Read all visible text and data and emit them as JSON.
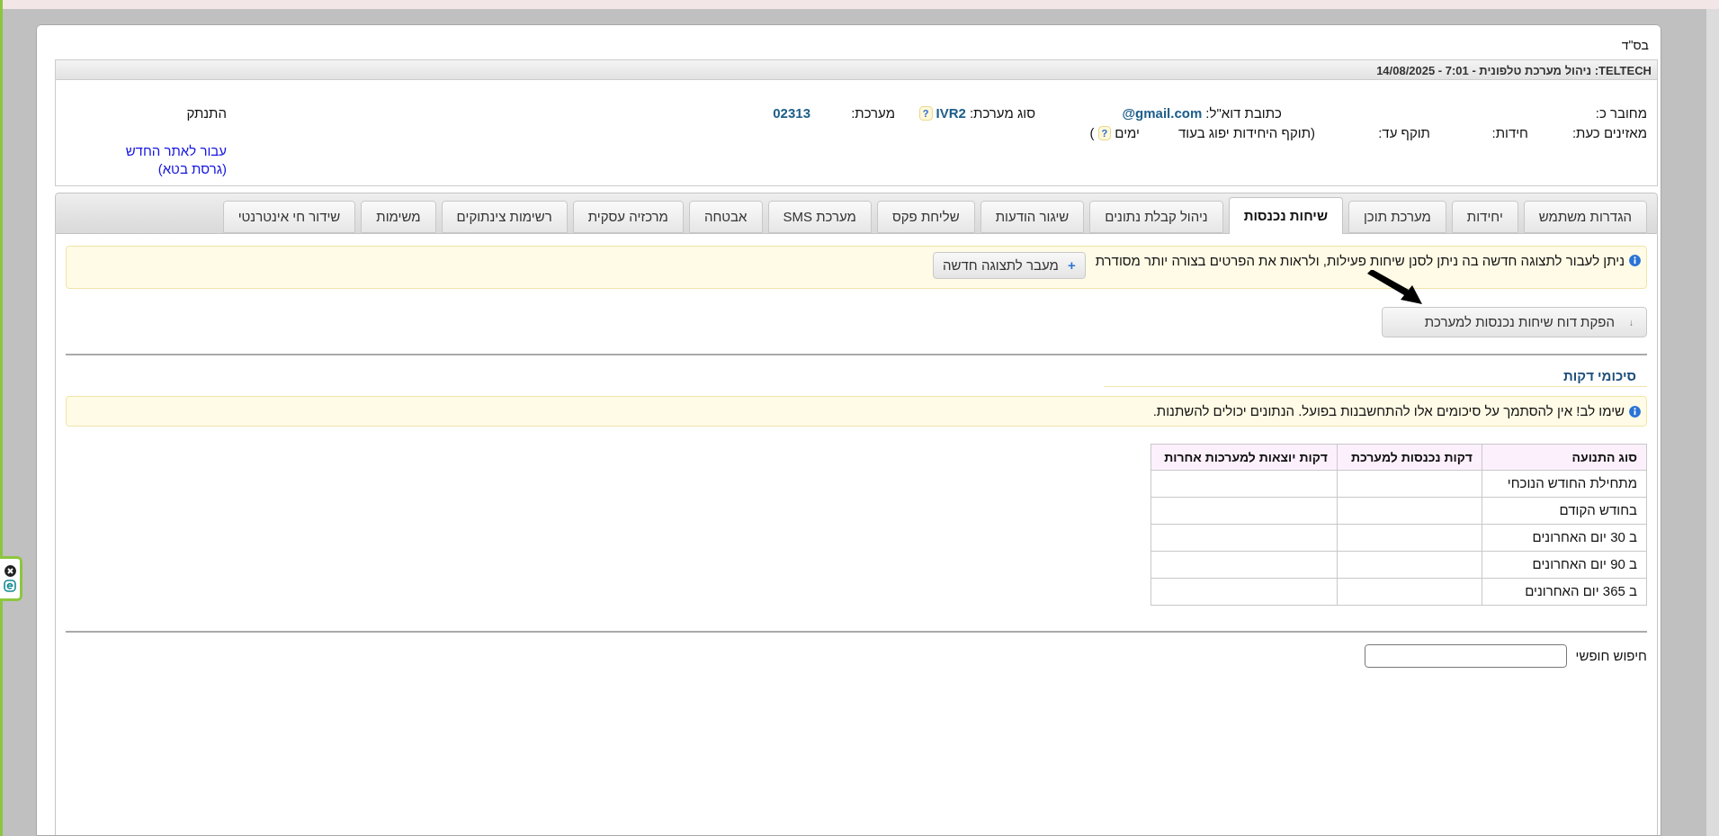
{
  "blessing": "בס\"ד",
  "title_bar": "TELTECH: ניהול מערכת טלפונית - 7:01 - 14/08/2025",
  "account": {
    "connected_as": "מחובר כ:",
    "email_label": "כתובת דוא\"ל:",
    "email": "@gmail.com",
    "system_type_label": "סוג מערכת:",
    "system_type": "IVR2",
    "system_type_help": "?",
    "system_label": "מערכת:",
    "system_number": "02313",
    "logout": "התנתק",
    "listeners_label": "מאזינים כעת:",
    "units_label": "חידות:",
    "valid_until_label": "תוקף עד:",
    "expiry_note": "(תוקף היחידות יפוג בעוד",
    "days": "ימים",
    "days_help": "?",
    "close_paren": ")",
    "new_site_link": "עבור לאתר החדש",
    "beta_link": "(גרסת בטא)"
  },
  "tabs": [
    {
      "label": "הגדרות משתמש",
      "selected": false
    },
    {
      "label": "יחידות",
      "selected": false
    },
    {
      "label": "מערכת תוכן",
      "selected": false
    },
    {
      "label": "שיחות נכנסות",
      "selected": true
    },
    {
      "label": "ניהול קבלת נתונים",
      "selected": false
    },
    {
      "label": "שיגור הודעות",
      "selected": false
    },
    {
      "label": "שליחת פקס",
      "selected": false
    },
    {
      "label": "מערכת SMS",
      "selected": false
    },
    {
      "label": "אבטחה",
      "selected": false
    },
    {
      "label": "מרכזיה עסקית",
      "selected": false
    },
    {
      "label": "רשימות צינתוקים",
      "selected": false
    },
    {
      "label": "משימות",
      "selected": false
    },
    {
      "label": "שידור חי אינטרנטי",
      "selected": false
    }
  ],
  "new_view_notice": {
    "text": "ניתן לעבור לתצוגה חדשה בה ניתן לסנן שיחות פעילות, ולראות את הפרטים בצורה יותר מסודרת",
    "button_icon": "+",
    "button": "מעבר לתצוגה חדשה"
  },
  "report_button": {
    "icon": "↓",
    "label": "הפקת דוח שיחות נכנסות למערכת"
  },
  "section_title": "סיכומי דקות",
  "warning": "שימו לב! אין להסתמך על סיכומים אלו להתחשבנות בפועל. הנתונים יכולים להשתנות.",
  "table": {
    "columns": [
      "סוג התנועה",
      "דקות נכנסות למערכת",
      "דקות יוצאות למערכות אחרות"
    ],
    "rows": [
      {
        "label": "מתחילת החודש הנוכחי"
      },
      {
        "label": "בחודש הקודם"
      },
      {
        "label": "ב 30 יום האחרונים"
      },
      {
        "label": "ב 90 יום האחרונים"
      },
      {
        "label": "ב 365 יום האחרונים"
      }
    ]
  },
  "free_search": {
    "label": "חיפוש חופשי"
  }
}
